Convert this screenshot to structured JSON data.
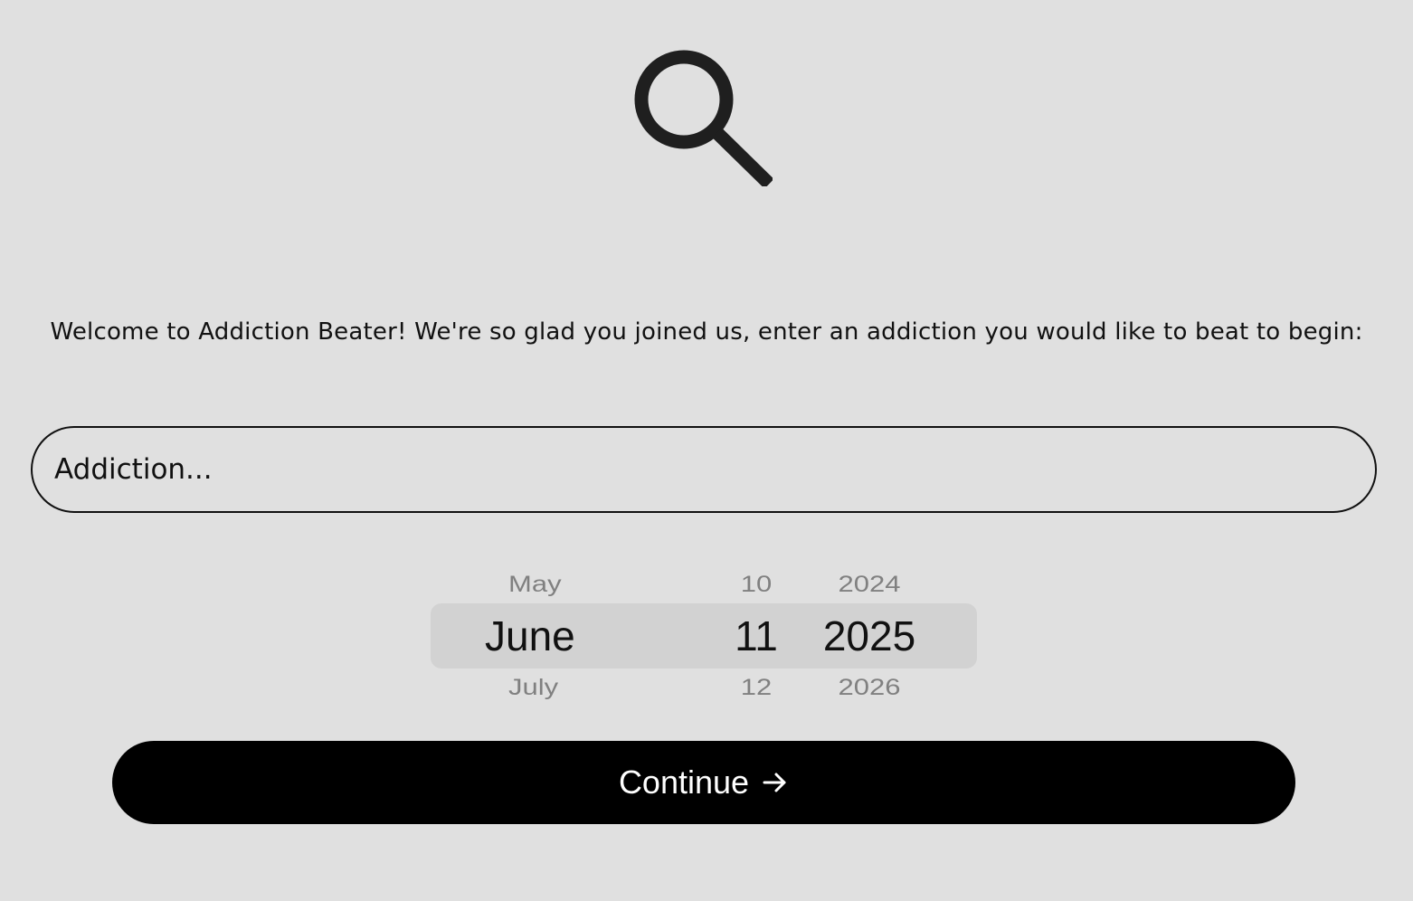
{
  "hero": {
    "icon": "search-icon"
  },
  "welcome": {
    "text": "Welcome to Addiction Beater! We're so glad you joined us, enter an addiction you would like to beat to begin:"
  },
  "addiction_input": {
    "placeholder": "Addiction...",
    "value": ""
  },
  "date_picker": {
    "month": {
      "prev": "May",
      "selected": "June",
      "next": "July"
    },
    "day": {
      "prev": "10",
      "selected": "11",
      "next": "12"
    },
    "year": {
      "prev": "2024",
      "selected": "2025",
      "next": "2026"
    }
  },
  "continue_button": {
    "label": "Continue",
    "icon": "arrow-right-icon"
  },
  "colors": {
    "background": "#e0e0e0",
    "button_bg": "#000000",
    "button_text": "#ffffff",
    "picker_highlight": "#d2d2d2",
    "muted_text": "#808080"
  }
}
